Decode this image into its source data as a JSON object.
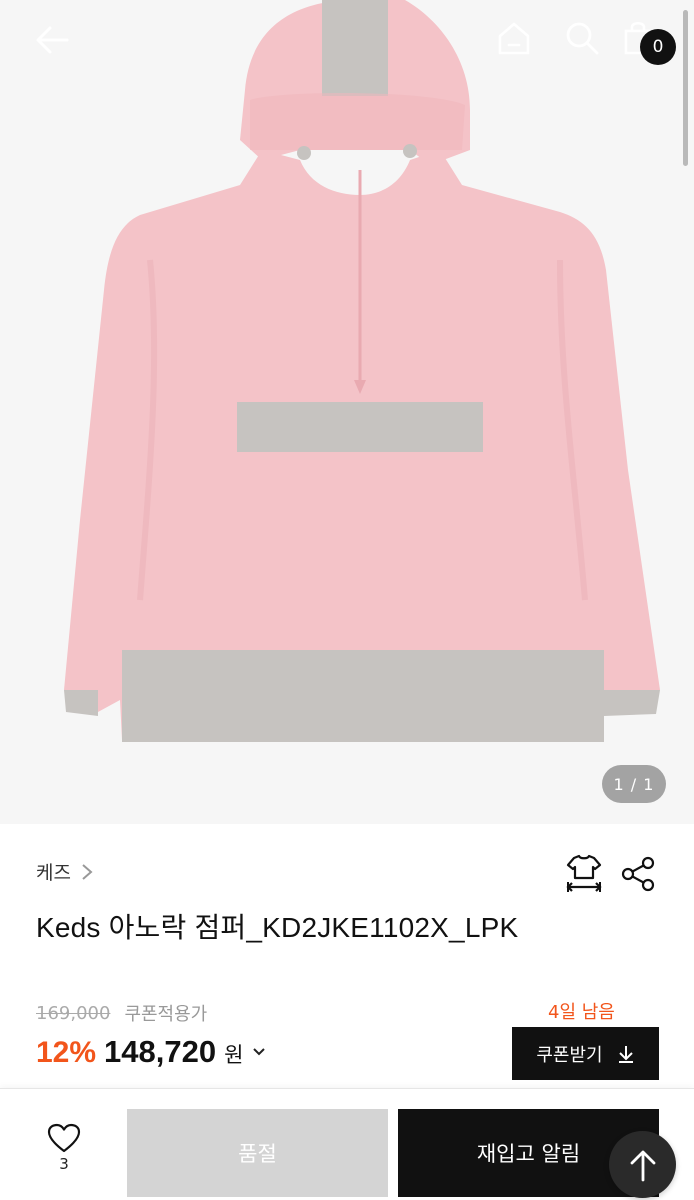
{
  "header": {
    "back_icon": "arrow-left-icon",
    "home_icon": "home-icon",
    "search_icon": "search-icon",
    "cart_icon": "shopping-bag-icon",
    "cart_count": "0"
  },
  "gallery": {
    "pager": "1 / 1"
  },
  "product": {
    "brand": "케즈",
    "name": "Keds 아노락 점퍼_KD2JKE1102X_LPK",
    "original_price": "169,000",
    "coupon_note": "쿠폰적용가",
    "discount_rate": "12%",
    "price": "148,720",
    "currency": "원",
    "days_left": "4일 남음",
    "coupon_button": "쿠폰받기"
  },
  "actions": {
    "like_count": "3",
    "soldout_label": "품절",
    "restock_label": "재입고 알림"
  },
  "colors": {
    "accent": "#f2551b",
    "jacket_pink": "#f4c3c8",
    "jacket_grey": "#c6c3c0",
    "button_dark": "#111111",
    "button_disabled": "#d4d4d4"
  }
}
